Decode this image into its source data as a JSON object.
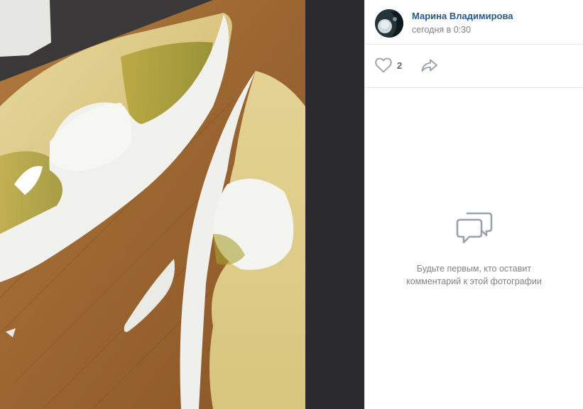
{
  "photo": {
    "subject": "photo-image"
  },
  "author": {
    "name": "Марина Владимирова",
    "time": "сегодня в 0:30",
    "avatar_icon": "avatar-photo"
  },
  "actions": {
    "like_icon": "heart-icon",
    "like_count": "2",
    "share_icon": "share-arrow-icon"
  },
  "comments": {
    "empty_icon": "comments-bubbles-icon",
    "empty_line1": "Будьте первым, кто оставит",
    "empty_line2": "комментарий к этой фотографии"
  },
  "colors": {
    "link": "#2a5885",
    "muted": "#828282",
    "divider": "#e7e8ec",
    "icon": "#99a2ad"
  }
}
